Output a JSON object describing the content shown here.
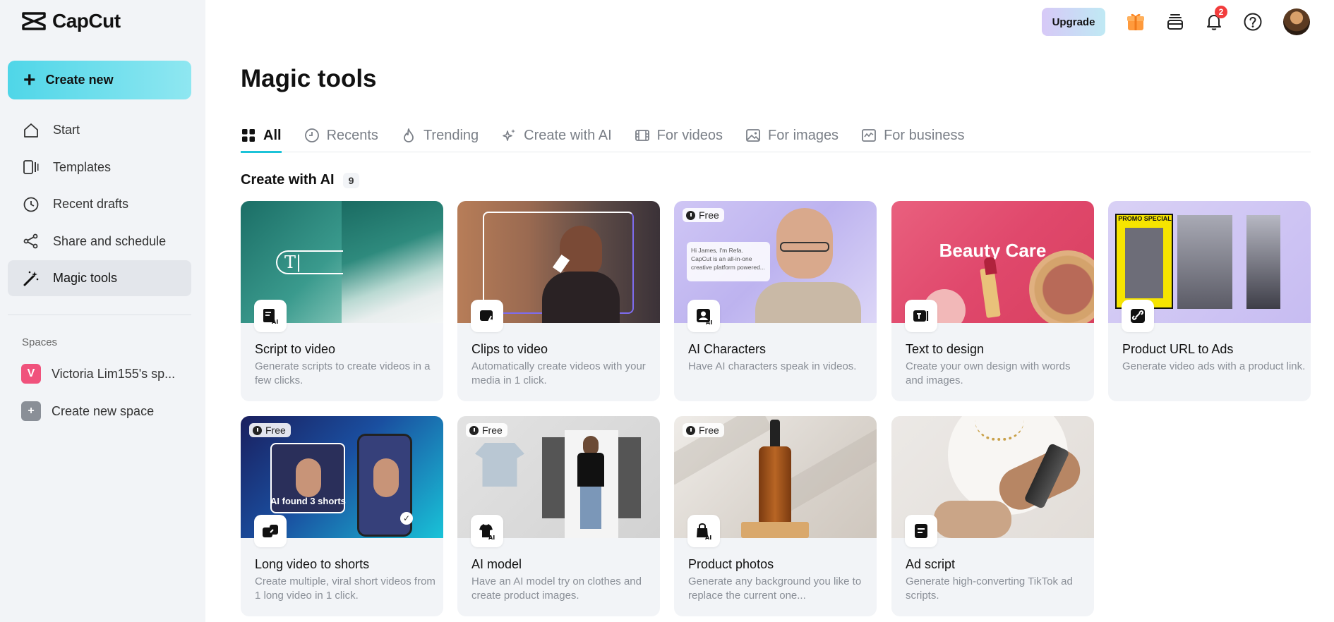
{
  "brand": {
    "name": "CapCut"
  },
  "sidebar": {
    "create_label": "Create new",
    "items": [
      {
        "label": "Start",
        "icon": "home-icon"
      },
      {
        "label": "Templates",
        "icon": "templates-icon"
      },
      {
        "label": "Recent drafts",
        "icon": "clock-icon"
      },
      {
        "label": "Share and schedule",
        "icon": "share-icon"
      },
      {
        "label": "Magic tools",
        "icon": "magic-wand-icon",
        "active": true
      }
    ],
    "spaces_title": "Spaces",
    "spaces": [
      {
        "badge": "V",
        "label": "Victoria Lim155's sp...",
        "color": "#f0527c"
      },
      {
        "badge": "+",
        "label": "Create new space",
        "color": "#8a8f97"
      }
    ]
  },
  "header": {
    "upgrade_label": "Upgrade",
    "notification_count": "2",
    "icons": [
      "gift-icon",
      "stack-icon",
      "bell-icon",
      "help-icon"
    ]
  },
  "main": {
    "title": "Magic tools",
    "tabs": [
      {
        "label": "All",
        "icon": "grid-icon",
        "active": true
      },
      {
        "label": "Recents",
        "icon": "clock-icon"
      },
      {
        "label": "Trending",
        "icon": "flame-icon"
      },
      {
        "label": "Create with AI",
        "icon": "sparkle-icon"
      },
      {
        "label": "For videos",
        "icon": "film-icon"
      },
      {
        "label": "For images",
        "icon": "image-icon"
      },
      {
        "label": "For business",
        "icon": "business-icon"
      }
    ],
    "section": {
      "title": "Create with AI",
      "count": "9"
    },
    "cards": [
      {
        "title": "Script to video",
        "desc": "Generate scripts to create videos in a few clicks.",
        "free": false
      },
      {
        "title": "Clips to video",
        "desc": "Automatically create videos with your media in 1 click.",
        "free": false
      },
      {
        "title": "AI Characters",
        "desc": "Have AI characters speak in videos.",
        "free": true
      },
      {
        "title": "Text to design",
        "desc": "Create your own design with words and images.",
        "free": false
      },
      {
        "title": "Product URL to Ads",
        "desc": "Generate video ads with a product link.",
        "free": false
      },
      {
        "title": "Long video to shorts",
        "desc": "Create multiple, viral short videos from 1 long video in 1 click.",
        "free": true
      },
      {
        "title": "AI model",
        "desc": "Have an AI model try on clothes and create product images.",
        "free": true
      },
      {
        "title": "Product photos",
        "desc": "Generate any background you like to replace the current one...",
        "free": true
      },
      {
        "title": "Ad script",
        "desc": "Generate high-converting TikTok ad scripts.",
        "free": false
      }
    ],
    "free_label": "Free",
    "thumb_text": {
      "beauty": "Beauty Care",
      "ai_found": "AI found 3 shorts",
      "chat_line1": "Hi James, I'm Refa.",
      "chat_line2": "CapCut is an all-in-one",
      "chat_line3": "creative platform powered...",
      "promo": "PROMO SPECIAL"
    }
  }
}
